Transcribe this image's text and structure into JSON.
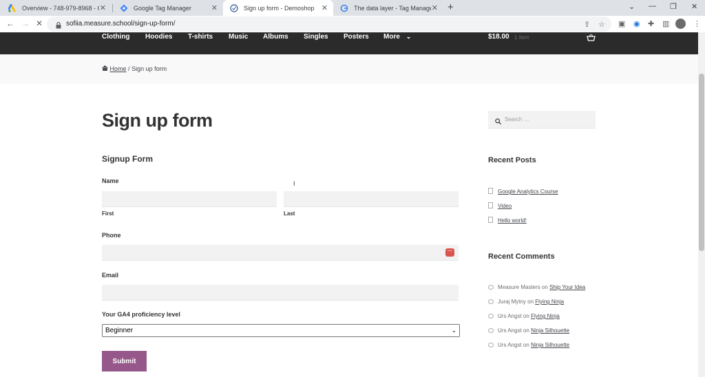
{
  "browser": {
    "tabs": [
      {
        "title": "Overview - 748-979-8968 - Goo",
        "icon": "google-ads-icon"
      },
      {
        "title": "Google Tag Manager",
        "icon": "gtm-icon"
      },
      {
        "title": "Sign up form - Demoshop",
        "icon": "demoshop-icon"
      },
      {
        "title": "The data layer - Tag Manager He",
        "icon": "google-icon"
      }
    ],
    "url": "sofiia.measure.school/sign-up-form/"
  },
  "site_nav": {
    "items": [
      "Clothing",
      "Hoodies",
      "T-shirts",
      "Music",
      "Albums",
      "Singles",
      "Posters",
      "More"
    ],
    "cart_total": "$18.00",
    "cart_items": "1 item"
  },
  "breadcrumb": {
    "home": "Home",
    "separator": "/",
    "current": "Sign up form"
  },
  "page": {
    "title": "Sign up form"
  },
  "form": {
    "title": "Signup Form",
    "name_label": "Name",
    "first_label": "First",
    "last_label": "Last",
    "phone_label": "Phone",
    "email_label": "Email",
    "level_label": "Your GA4 proficiency level",
    "level_value": "Beginner",
    "submit_label": "Submit"
  },
  "sidebar": {
    "search_placeholder": "Search …",
    "recent_posts_title": "Recent Posts",
    "recent_posts": [
      "Google Analytics Course",
      "Video",
      "Hello world!"
    ],
    "recent_comments_title": "Recent Comments",
    "recent_comments": [
      {
        "author": "Measure Masters",
        "on": "on",
        "post": "Ship Your Idea"
      },
      {
        "author": "Juraj Mytny",
        "on": "on",
        "post": "Flying Ninja"
      },
      {
        "author": "Urs Angst",
        "on": "on",
        "post": "Flying Ninja"
      },
      {
        "author": "Urs Angst",
        "on": "on",
        "post": "Ninja Silhouette"
      },
      {
        "author": "Urs Angst",
        "on": "on",
        "post": "Ninja Silhouette"
      }
    ]
  },
  "colors": {
    "accent_button": "#96588a",
    "nav_bg": "#2b2b2b"
  }
}
